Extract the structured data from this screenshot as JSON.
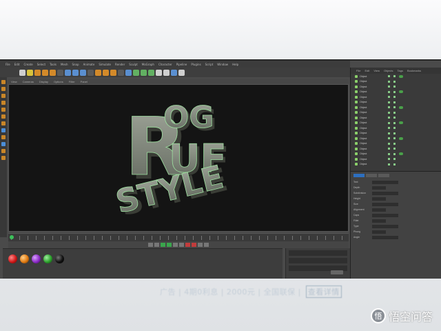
{
  "app": {
    "menu": [
      "File",
      "Edit",
      "Create",
      "Select",
      "Tools",
      "Mesh",
      "Snap",
      "Animate",
      "Simulate",
      "Render",
      "Sculpt",
      "MoGraph",
      "Character",
      "Pipeline",
      "Plugins",
      "Script",
      "Window",
      "Help"
    ],
    "viewport_menu": [
      "View",
      "Cameras",
      "Display",
      "Options",
      "Filter",
      "Panel"
    ]
  },
  "viewport": {
    "line1": "ROG",
    "line2": "RUF",
    "line3": "STYLE",
    "text_color": "#7e8479",
    "edge_color": "#9ddf9f",
    "background": "#141414"
  },
  "materials": {
    "swatches": [
      {
        "color": "#d01818"
      },
      {
        "color": "#e07a12"
      },
      {
        "color": "#8c2cc6"
      },
      {
        "color": "#2ca02c"
      },
      {
        "color": "#101010"
      }
    ]
  },
  "object_manager": {
    "menu": [
      "File",
      "Edit",
      "View",
      "Objects",
      "Tags",
      "Bookmarks"
    ],
    "rows": [
      "Object",
      "Object",
      "Object",
      "Object",
      "Object",
      "Object",
      "Object",
      "Object",
      "Object",
      "Object",
      "Object",
      "Object",
      "Object",
      "Object",
      "Object",
      "Object",
      "Object",
      "Object"
    ]
  },
  "attribute_manager": {
    "tabs": [
      "Basic",
      "Coord",
      "Object"
    ],
    "rows": [
      "Text",
      "Depth",
      "Subdivision",
      "Height",
      "Size",
      "Alignment",
      "Caps",
      "Fillet",
      "Type",
      "Phong",
      "Angle"
    ]
  },
  "caption": {
    "text": "广告 | 4期0利息 | 2000元 | 全国联保 | ",
    "button": "查看详情"
  },
  "watermark": {
    "icon_text": "悟",
    "text": "悟空问答"
  }
}
